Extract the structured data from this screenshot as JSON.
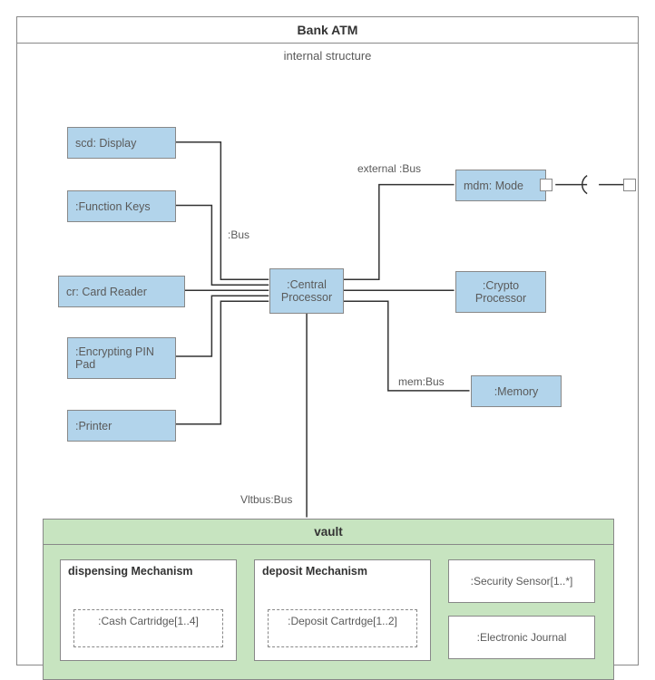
{
  "diagram": {
    "title": "Bank ATM",
    "subtitle": "internal structure",
    "nodes": {
      "display": "scd: Display",
      "function_keys": ":Function Keys",
      "card_reader": "cr: Card Reader",
      "pin_pad": ":Encrypting PIN Pad",
      "printer": ":Printer",
      "cpu": ":Central Processor",
      "modem": "mdm: Mode",
      "crypto": ":Crypto Processor",
      "memory": ":Memory"
    },
    "labels": {
      "bus": ":Bus",
      "external_bus": "external :Bus",
      "mem_bus": "mem:Bus",
      "vlt_bus": "Vltbus:Bus"
    },
    "vault": {
      "title": "vault",
      "dispensing": {
        "title": "dispensing Mechanism",
        "inner": ":Cash Cartridge[1..4]"
      },
      "deposit": {
        "title": "deposit Mechanism",
        "inner": ":Deposit Cartrdge[1..2]"
      },
      "sensor": ":Security Sensor[1..*]",
      "journal": ":Electronic Journal"
    }
  }
}
